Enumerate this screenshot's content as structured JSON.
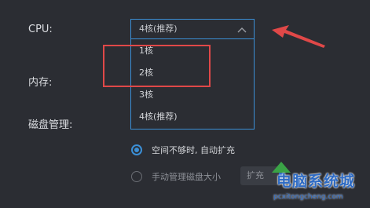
{
  "settings": {
    "cpu_label": "CPU:",
    "memory_label": "内存:",
    "disk_label": "磁盘管理:"
  },
  "cpu_select": {
    "value": "4核(推荐)",
    "icon": "chevron-up-icon",
    "options": [
      "1核",
      "2核",
      "3核",
      "4核(推荐)"
    ]
  },
  "disk_options": {
    "auto": {
      "label": "空间不够时, 自动扩充",
      "selected": true
    },
    "manual": {
      "label": "手动管理磁盘大小",
      "selected": false
    },
    "expand_button": "扩充"
  },
  "watermark": {
    "text": "电脑系统城",
    "url": "pcxitongcheng.com"
  },
  "colors": {
    "background": "#2b2d33",
    "accent": "#3b8fd6",
    "highlight": "#e04848"
  }
}
